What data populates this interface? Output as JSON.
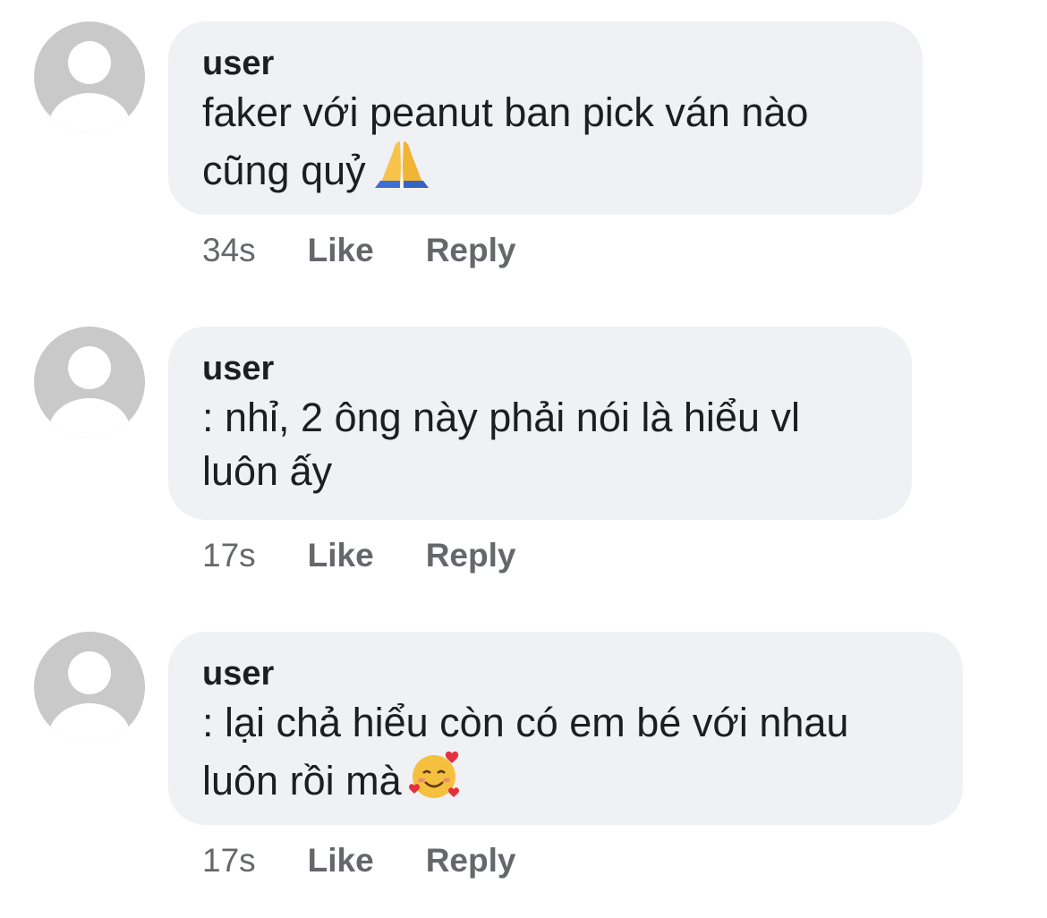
{
  "comments": [
    {
      "username": "user",
      "text": "faker với peanut ban pick ván nào\ncũng quỷ",
      "emoji": "folded-hands-emoji",
      "time": "34s",
      "like": "Like",
      "reply": "Reply"
    },
    {
      "username": "user",
      "text": ": nhỉ, 2 ông này phải nói là hiểu vl\nluôn ấy",
      "emoji": "",
      "time": "17s",
      "like": "Like",
      "reply": "Reply"
    },
    {
      "username": "user",
      "text": ": lại chả hiểu còn có em bé với nhau\nluôn rồi mà",
      "emoji": "smiling-face-with-hearts-emoji",
      "time": "17s",
      "like": "Like",
      "reply": "Reply"
    }
  ],
  "colors": {
    "bubble": "#f0f1f4",
    "avatar": "#c9c9c9",
    "text": "#1c1e21",
    "meta": "#65676b"
  }
}
